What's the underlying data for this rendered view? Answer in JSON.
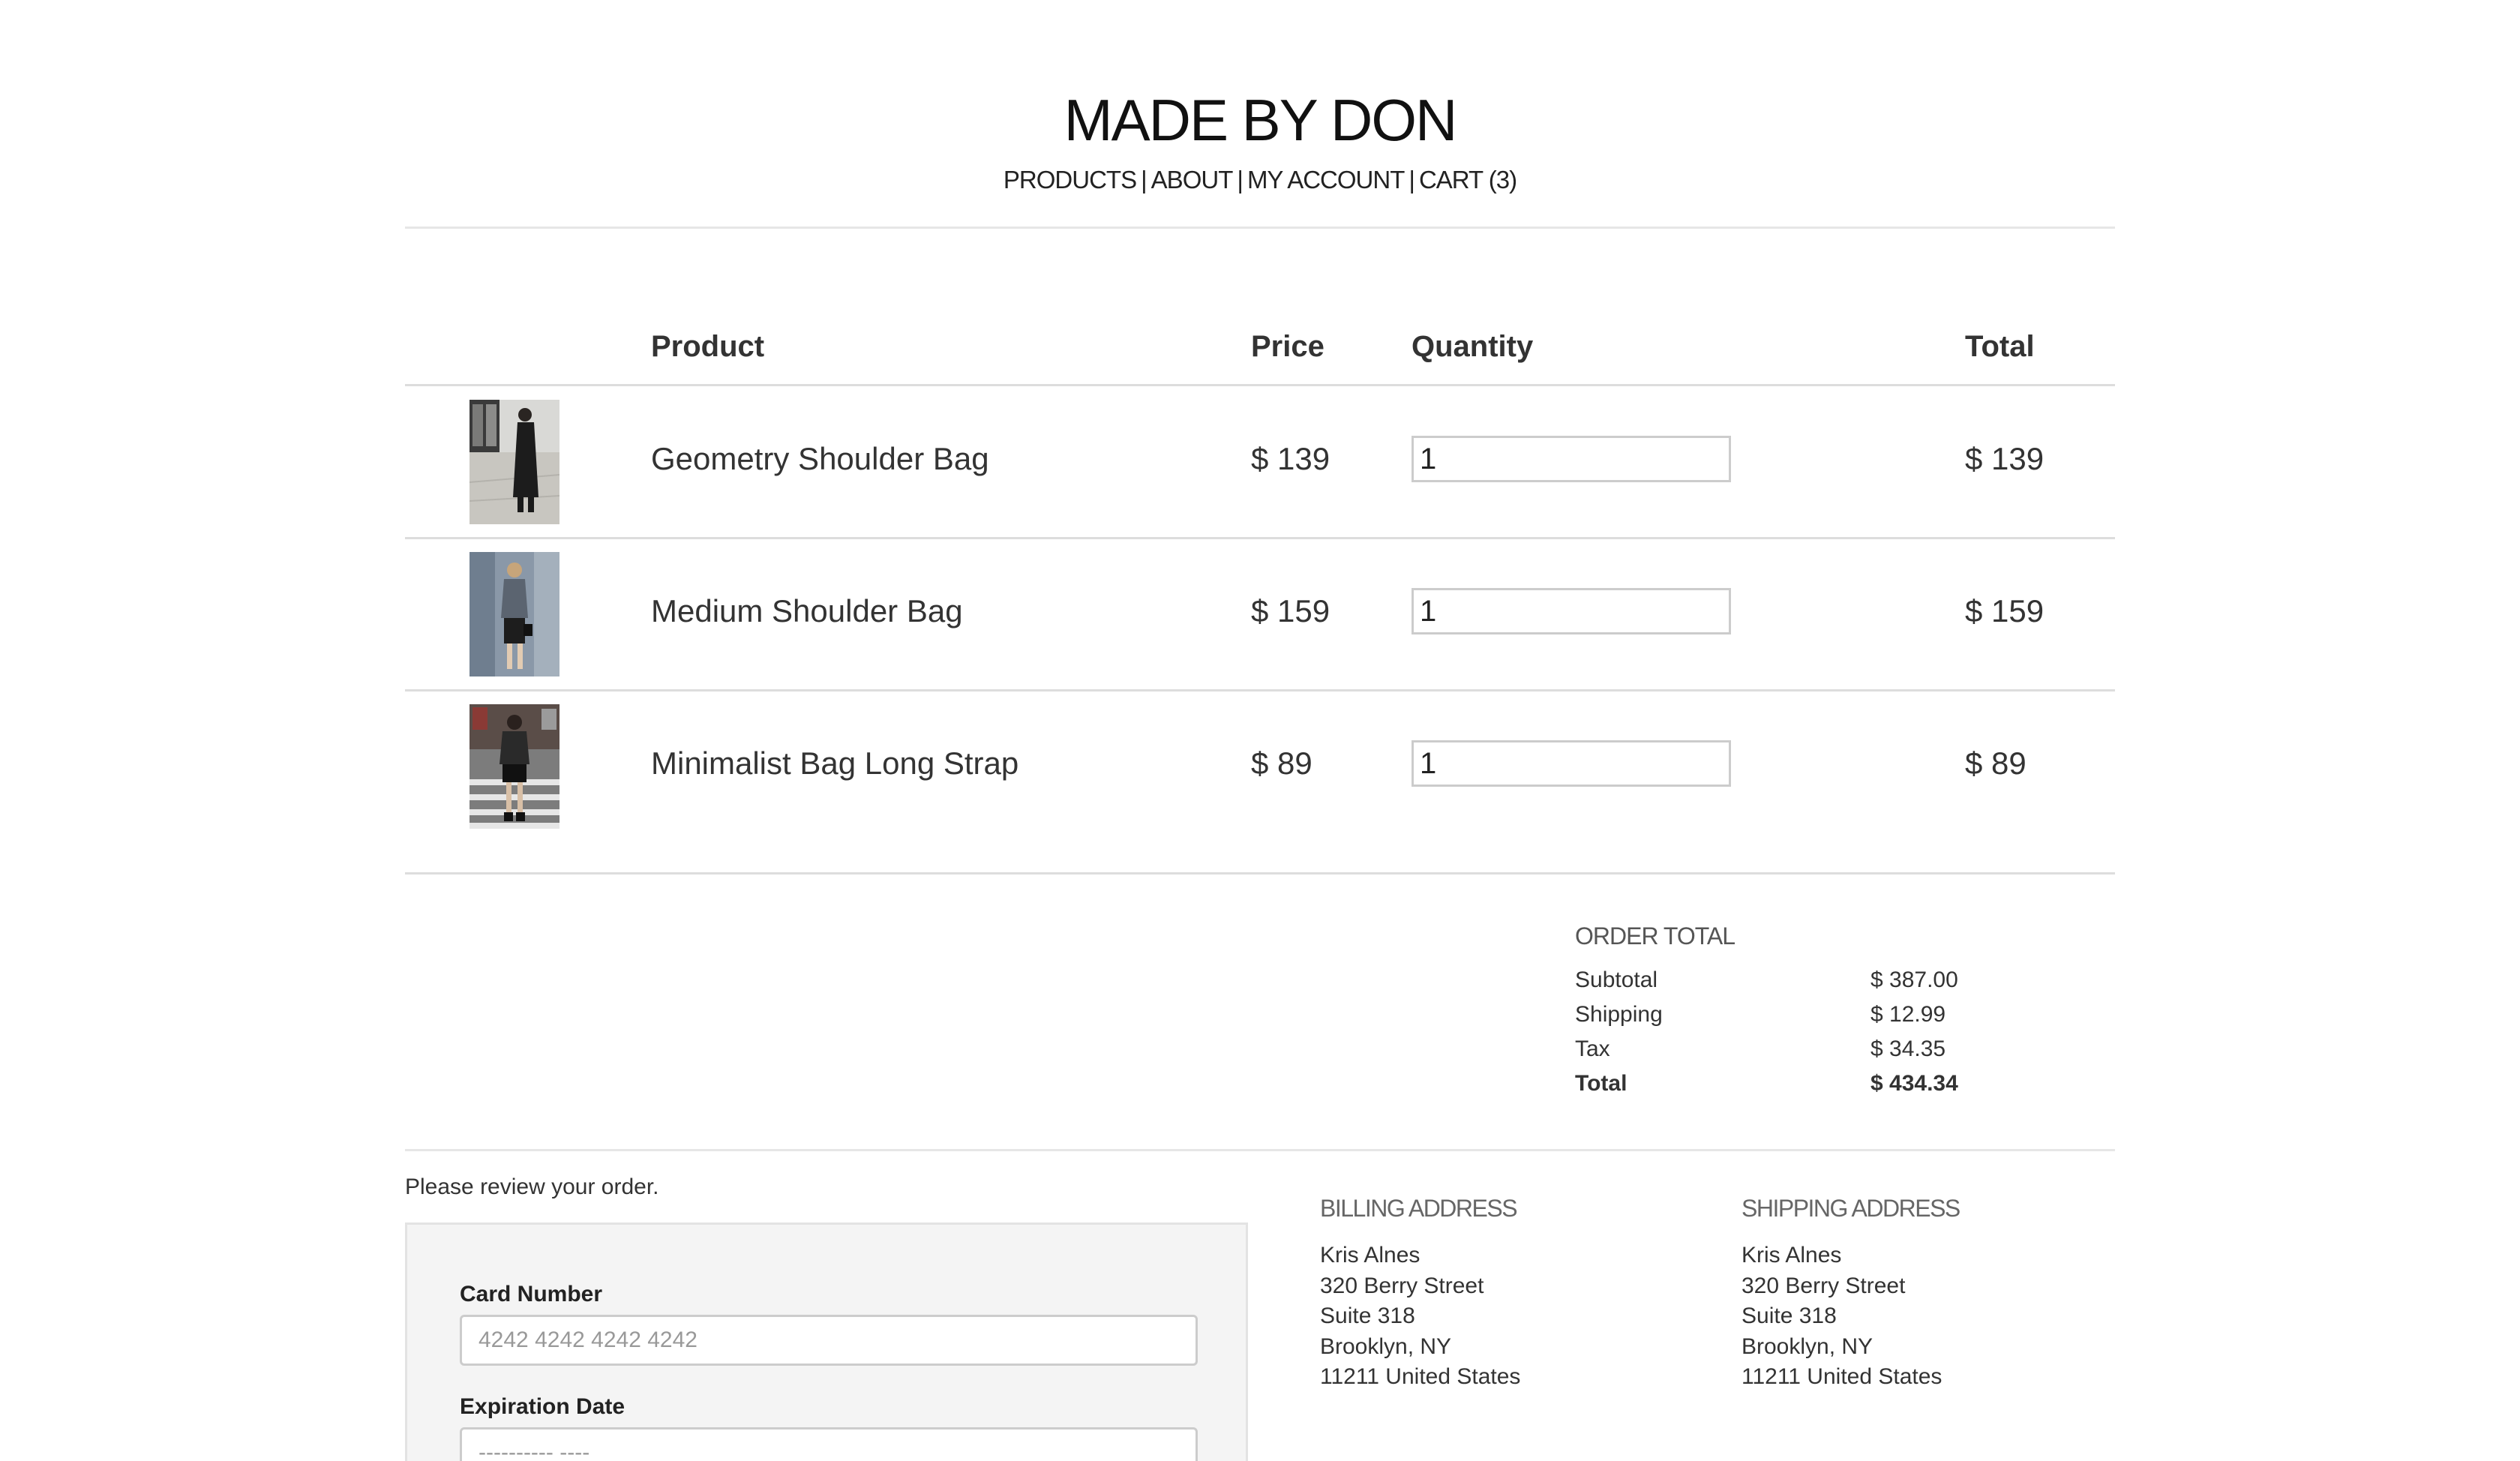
{
  "header": {
    "title": "MADE BY DON",
    "nav": [
      "PRODUCTS",
      "ABOUT",
      "MY ACCOUNT",
      "CART (3)"
    ]
  },
  "cart": {
    "columns": {
      "product": "Product",
      "price": "Price",
      "quantity": "Quantity",
      "total": "Total"
    },
    "items": [
      {
        "name": "Geometry Shoulder Bag",
        "price": "$ 139",
        "quantity": "1",
        "total": "$ 139"
      },
      {
        "name": "Medium Shoulder Bag",
        "price": "$ 159",
        "quantity": "1",
        "total": "$ 159"
      },
      {
        "name": "Minimalist Bag Long Strap",
        "price": "$ 89",
        "quantity": "1",
        "total": "$ 89"
      }
    ]
  },
  "order_total": {
    "heading": "ORDER TOTAL",
    "subtotal_label": "Subtotal",
    "subtotal_value": "$ 387.00",
    "shipping_label": "Shipping",
    "shipping_value": "$ 12.99",
    "tax_label": "Tax",
    "tax_value": "$ 34.35",
    "total_label": "Total",
    "total_value": "$ 434.34"
  },
  "payment": {
    "review_note": "Please review your order.",
    "card_number_label": "Card Number",
    "card_number_placeholder": "4242 4242 4242 4242",
    "expiration_label": "Expiration Date",
    "expiration_placeholder": "---------- ----"
  },
  "billing_address": {
    "heading": "BILLING ADDRESS",
    "name": "Kris Alnes",
    "street": "320 Berry Street",
    "suite": "Suite 318",
    "city": "Brooklyn, NY",
    "zip_country": "11211 United States"
  },
  "shipping_address": {
    "heading": "SHIPPING ADDRESS",
    "name": "Kris Alnes",
    "street": "320 Berry Street",
    "suite": "Suite 318",
    "city": "Brooklyn, NY",
    "zip_country": "11211 United States"
  }
}
